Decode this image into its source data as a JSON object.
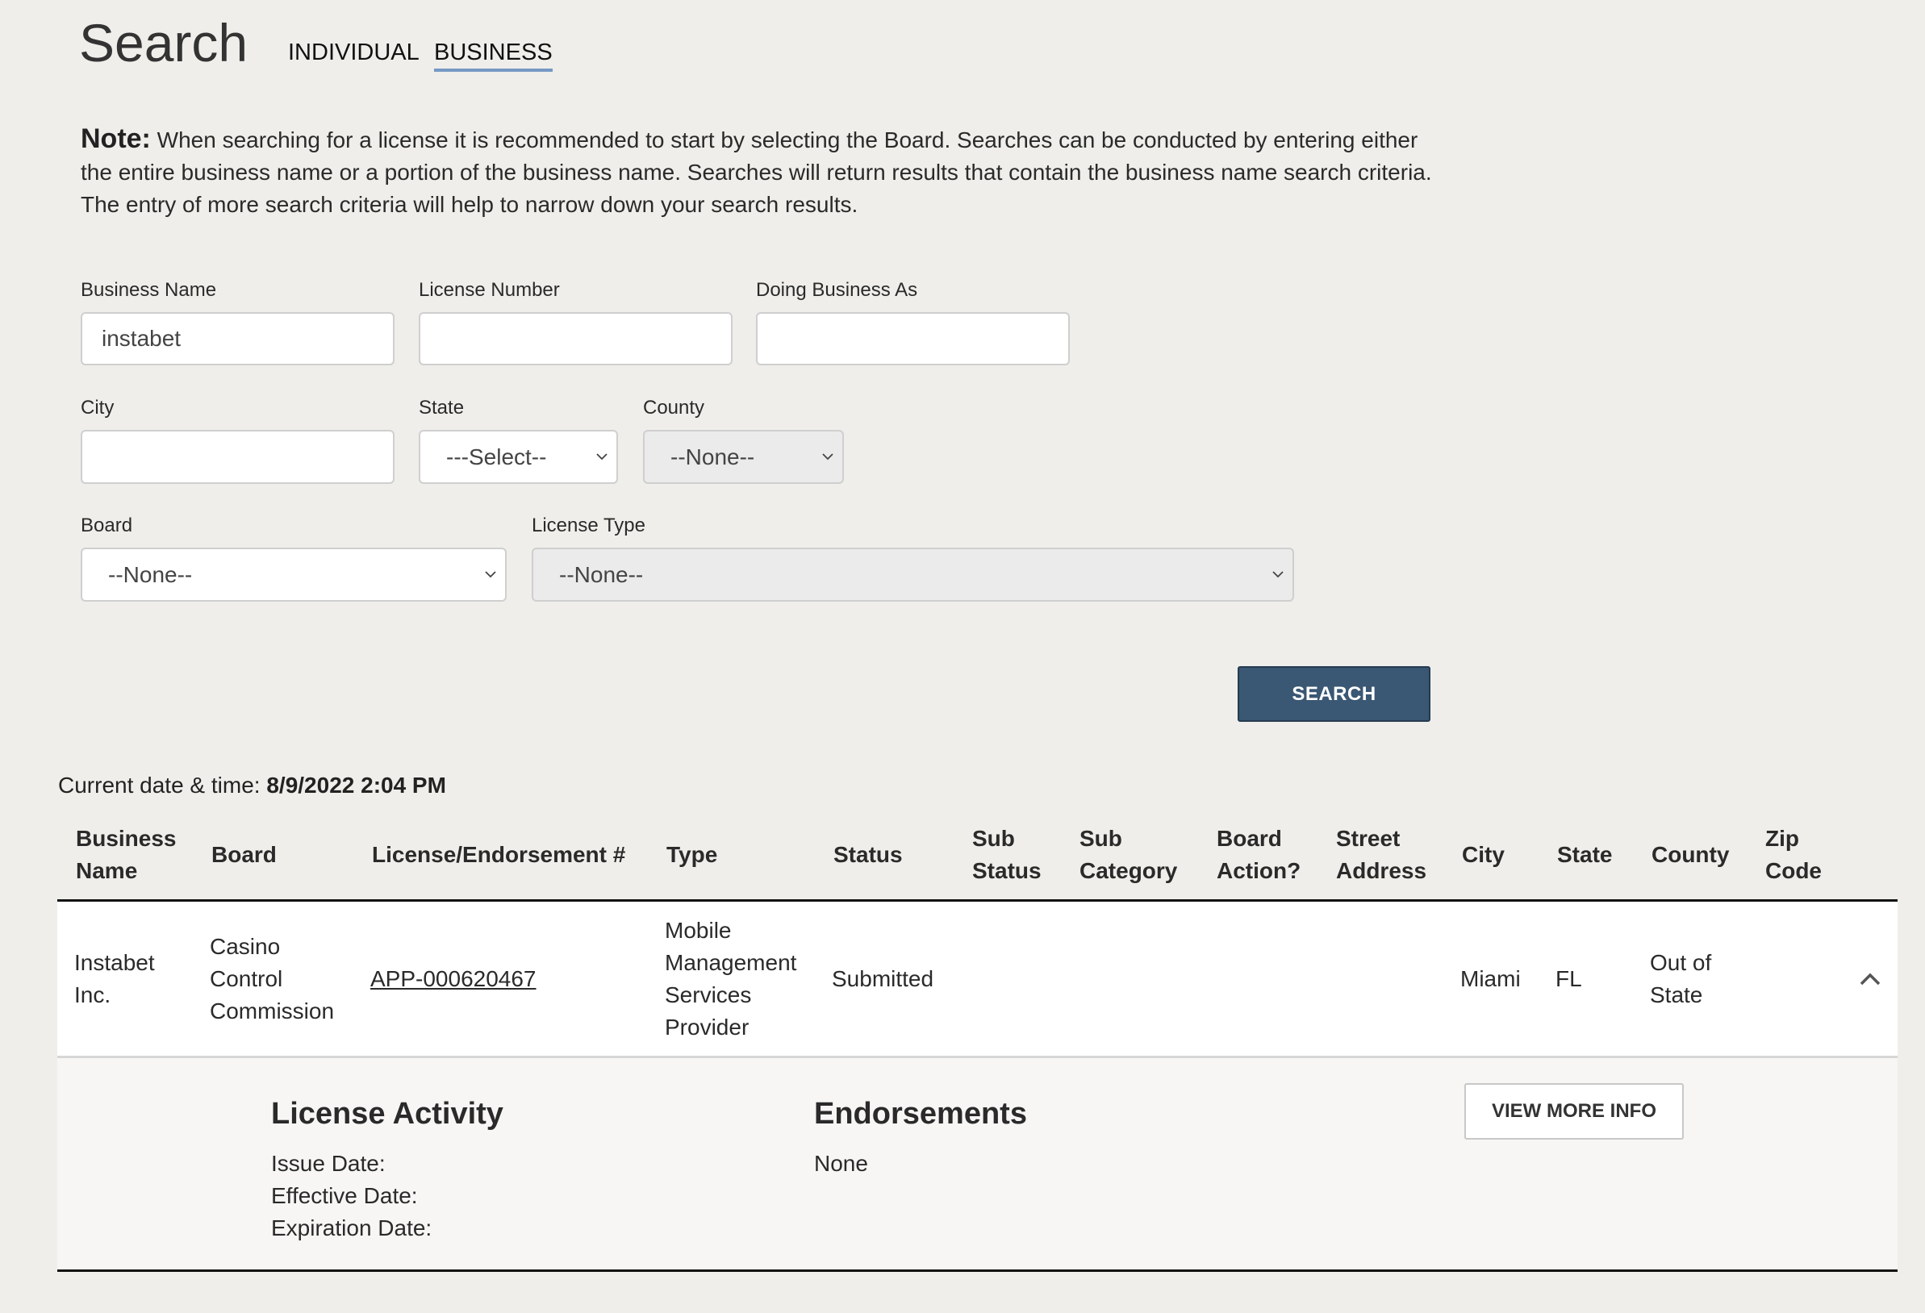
{
  "header": {
    "title": "Search",
    "tabs": [
      {
        "label": "INDIVIDUAL",
        "active": false
      },
      {
        "label": "BUSINESS",
        "active": true
      }
    ]
  },
  "note": {
    "label": "Note:",
    "text": "When searching for a license it is recommended to start by selecting the Board. Searches can be conducted by entering either the entire business name or a portion of the business name. Searches will return results that contain the business name search criteria. The entry of more search criteria will help to narrow down your search results."
  },
  "form": {
    "business_name": {
      "label": "Business Name",
      "value": "instabet"
    },
    "license_number": {
      "label": "License Number",
      "value": ""
    },
    "dba": {
      "label": "Doing Business As",
      "value": ""
    },
    "city": {
      "label": "City",
      "value": ""
    },
    "state": {
      "label": "State",
      "selected": "---Select--"
    },
    "county": {
      "label": "County",
      "selected": "--None--"
    },
    "board": {
      "label": "Board",
      "selected": "--None--"
    },
    "license_type": {
      "label": "License Type",
      "selected": "--None--"
    },
    "search_button": "SEARCH"
  },
  "results": {
    "datetime_label": "Current date & time:",
    "datetime_value": "8/9/2022 2:04 PM",
    "columns": [
      "Business Name",
      "Board",
      "License/Endorsement #",
      "Type",
      "Status",
      "Sub Status",
      "Sub Category",
      "Board Action?",
      "Street Address",
      "City",
      "State",
      "County",
      "Zip Code"
    ],
    "rows": [
      {
        "business_name": "Instabet Inc.",
        "board": "Casino Control Commission",
        "license": "APP-000620467",
        "type": "Mobile Management Services Provider",
        "status": "Submitted",
        "sub_status": "",
        "sub_category": "",
        "board_action": "",
        "street_address": "",
        "city": "Miami",
        "state": "FL",
        "county": "Out of State",
        "zip": "",
        "expanded": true,
        "details": {
          "license_activity_title": "License Activity",
          "issue_date_label": "Issue Date:",
          "effective_date_label": "Effective Date:",
          "expiration_date_label": "Expiration Date:",
          "endorsements_title": "Endorsements",
          "endorsements_value": "None",
          "view_more_button": "VIEW MORE INFO"
        }
      }
    ]
  },
  "colors": {
    "page_bg": "#efeeea",
    "accent_underline": "#7699c4",
    "primary_button": "#3a5773",
    "expanded_bg": "#f7f6f4"
  }
}
